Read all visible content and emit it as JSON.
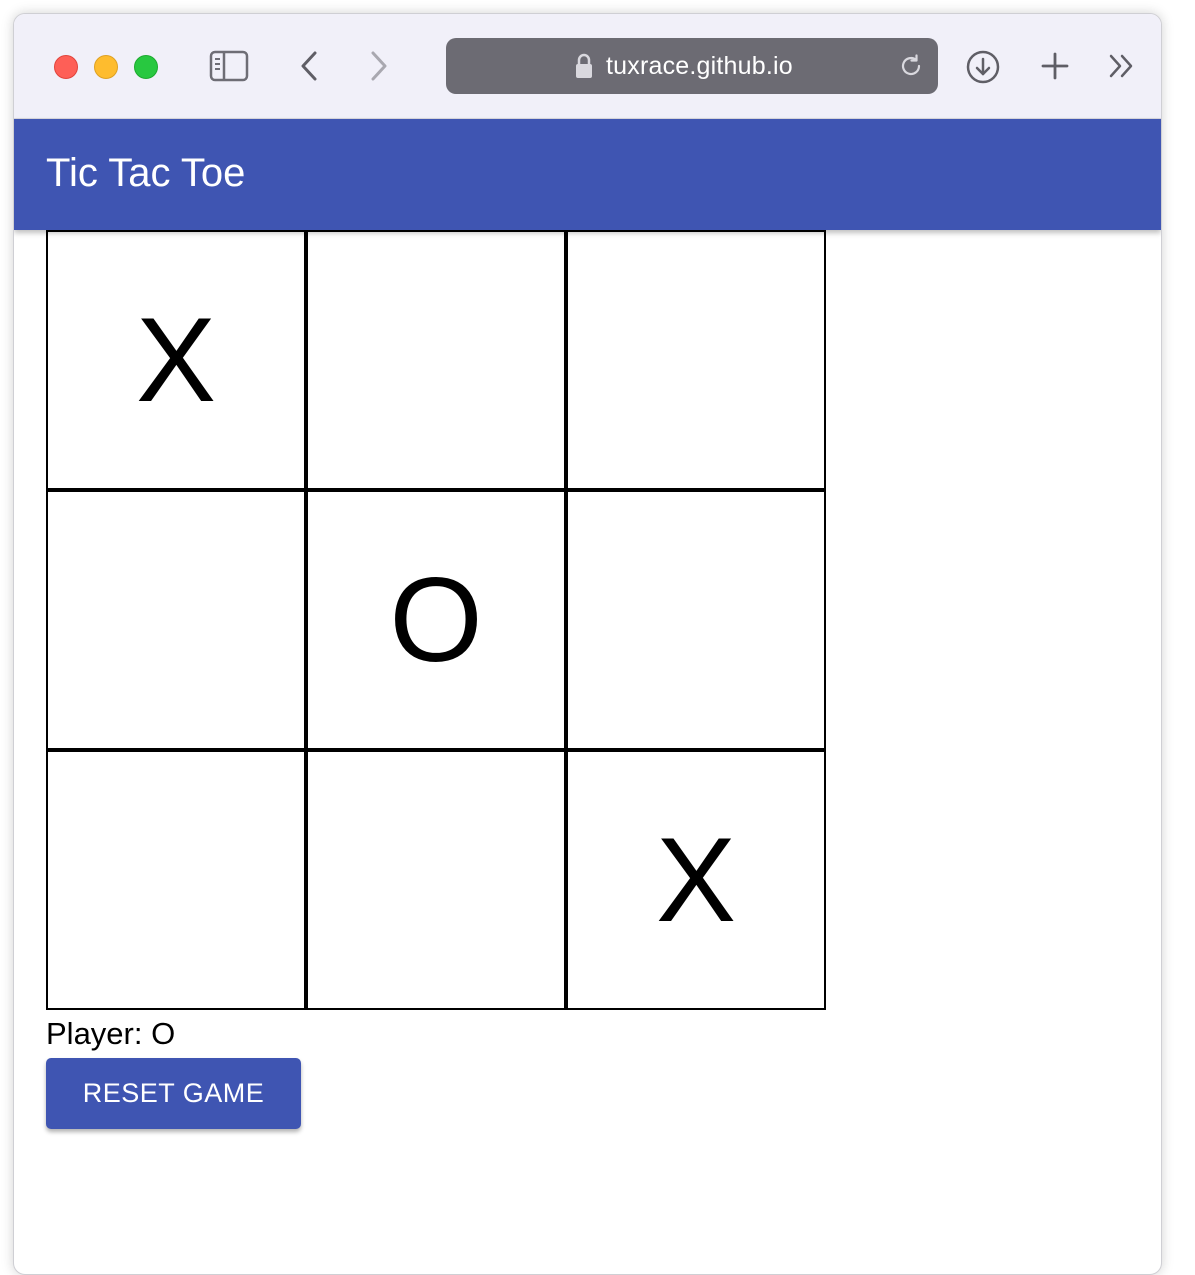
{
  "browser": {
    "url": "tuxrace.github.io",
    "icons": {
      "sidebar": "sidebar-icon",
      "back": "chevron-left-icon",
      "forward": "chevron-right-icon",
      "lock": "lock-icon",
      "reload": "reload-icon",
      "download": "download-icon",
      "new_tab": "plus-icon",
      "more": "double-chevron-right-icon"
    },
    "colors": {
      "close": "#fe5f57",
      "minimize": "#febc2e",
      "maximize": "#28c840"
    }
  },
  "app": {
    "title": "Tic Tac Toe",
    "accent": "#3f55b2"
  },
  "board": {
    "cells": [
      "X",
      "",
      "",
      "",
      "O",
      "",
      "",
      "",
      "X"
    ]
  },
  "status": {
    "player_text": "Player: O"
  },
  "actions": {
    "reset_label": "RESET GAME"
  }
}
